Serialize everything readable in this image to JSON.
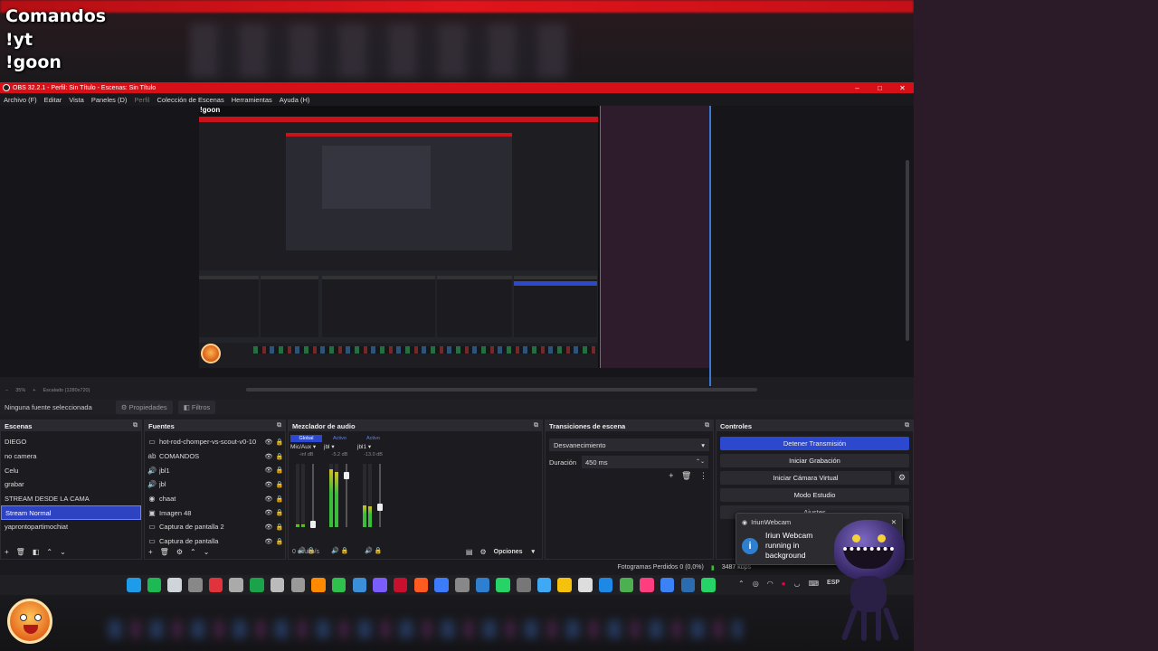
{
  "overlay": {
    "commands": [
      "Comandos",
      "!yt",
      "!goon"
    ]
  },
  "window": {
    "title": "OBS 32.2.1 - Perfil: Sin Título - Escenas: Sin Título",
    "controls": [
      "–",
      "□",
      "✕"
    ]
  },
  "menu": [
    "Archivo (F)",
    "Editar",
    "Vista",
    "Paneles (D)",
    "Perfil",
    "Colección de Escenas",
    "Herramientas",
    "Ayuda (H)"
  ],
  "preview": {
    "nested_cmd": "!goon",
    "zoom": "35%",
    "scale": "Escalado (1280x720)"
  },
  "selection": {
    "label": "Ninguna fuente seleccionada",
    "properties": "Propiedades",
    "filters": "Filtros"
  },
  "scenes": {
    "title": "Escenas",
    "items": [
      "DIEGO",
      "no camera",
      "Celu",
      "grabar",
      "STREAM DESDE LA CAMA",
      "Stream Normal",
      "yaprontopartimochiat"
    ],
    "selected": "Stream Normal"
  },
  "sources": {
    "title": "Fuentes",
    "items": [
      {
        "icon": "window-icon",
        "glyph": "▭",
        "name": "hot-rod-chomper-vs-scout-v0-10"
      },
      {
        "icon": "text-icon",
        "glyph": "ab",
        "name": "COMANDOS"
      },
      {
        "icon": "speaker-icon",
        "glyph": "🔊",
        "name": "jbl1"
      },
      {
        "icon": "speaker-icon",
        "glyph": "🔊",
        "name": "jbl"
      },
      {
        "icon": "browser-icon",
        "glyph": "◉",
        "name": "chaat"
      },
      {
        "icon": "image-icon",
        "glyph": "▣",
        "name": "Imagen 48"
      },
      {
        "icon": "display-capture-icon",
        "glyph": "▭",
        "name": "Captura de pantalla 2"
      },
      {
        "icon": "display-capture-icon",
        "glyph": "▭",
        "name": "Captura de pantalla"
      }
    ]
  },
  "mixer": {
    "title": "Mezclador de audio",
    "channels": [
      {
        "tag": "Global",
        "name": "Mic/Aux",
        "db": "-inf dB",
        "level": 0.05
      },
      {
        "tag": "Activo",
        "name": "jbl",
        "db": "-5.2 dB",
        "level": 0.92
      },
      {
        "tag": "Activo",
        "name": "jbl1",
        "db": "-13.0 dB",
        "level": 0.35
      }
    ],
    "hidden": "0 oculto/s",
    "options": "Opciones"
  },
  "transitions": {
    "title": "Transiciones de escena",
    "selected": "Desvanecimiento",
    "duration_label": "Duración",
    "duration": "450 ms"
  },
  "controls": {
    "title": "Controles",
    "buttons": [
      "Detener Transmisión",
      "Iniciar Grabación",
      "Iniciar Cámara Virtual",
      "Modo Estudio",
      "Ajustes"
    ]
  },
  "toast": {
    "app": "IriunWebcam",
    "message": "Iriun Webcam running in background"
  },
  "status": {
    "dropped": "Fotogramas Perdidos 0 (0,0%)",
    "bitrate": "3487 kbps"
  },
  "tray": {
    "lang": "ESP"
  },
  "colors": {
    "accent": "#2b48cf",
    "brand_red": "#d61016",
    "live_green": "#3bbd3b"
  }
}
